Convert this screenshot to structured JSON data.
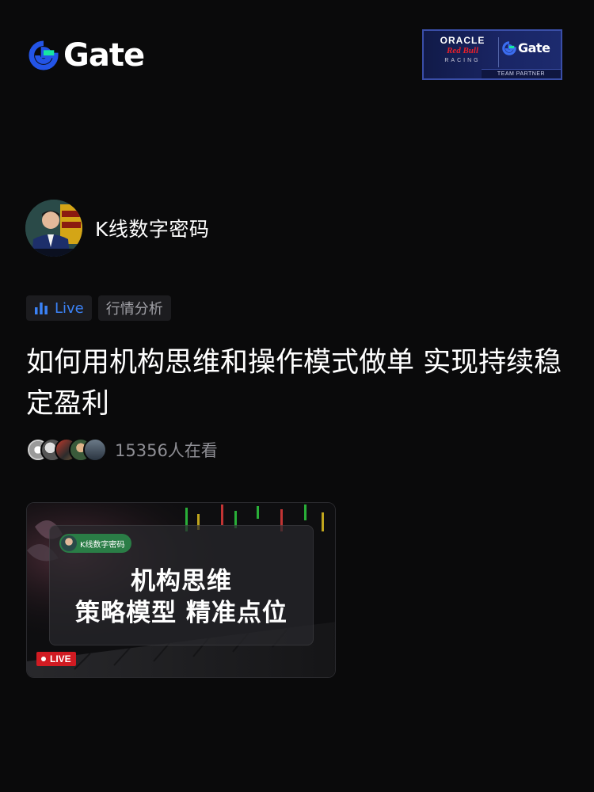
{
  "header": {
    "brand": "Gate",
    "partner_badge": {
      "oracle": "ORACLE",
      "redbull": "Red Bull",
      "racing": "RACING",
      "gate": "Gate",
      "footer": "TEAM PARTNER"
    }
  },
  "streamer": {
    "name": "K线数字密码",
    "avatar_icon": "streamer-avatar"
  },
  "tags": {
    "live_label": "Live",
    "category_label": "行情分析"
  },
  "stream": {
    "title": "如何用机构思维和操作模式做单 实现持续稳定盈利",
    "viewers_text": "15356人在看"
  },
  "thumbnail": {
    "chip_name": "K线数字密码",
    "line1": "机构思维",
    "line2": "策略模型 精准点位",
    "live_badge": "LIVE"
  },
  "colors": {
    "background": "#0a0a0b",
    "accent_blue": "#3b82f6",
    "gate_blue": "#2354e6",
    "gate_green": "#17e6a1",
    "live_red": "#d11b22"
  }
}
